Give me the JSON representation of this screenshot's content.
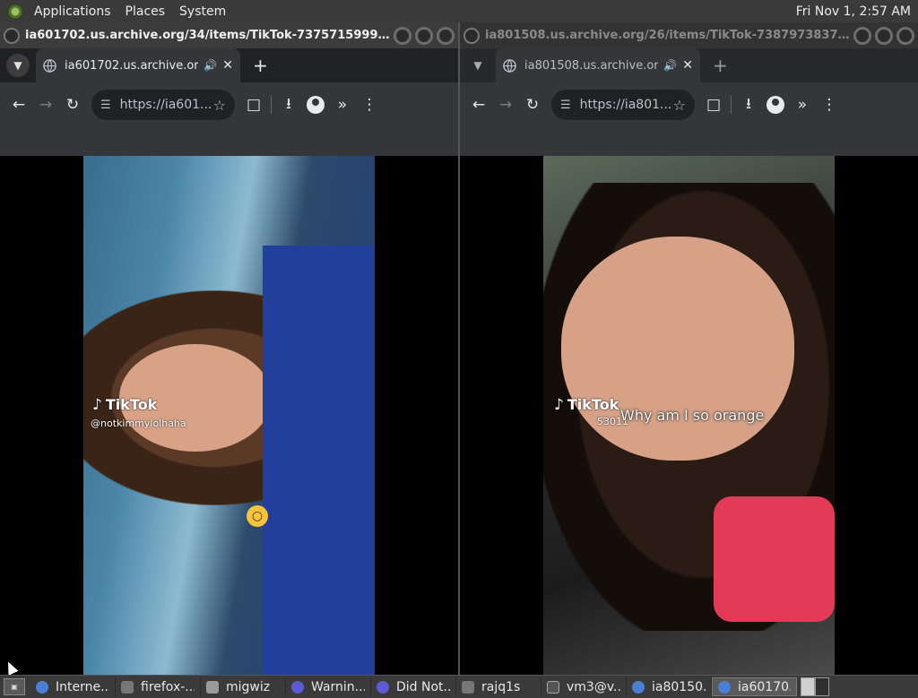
{
  "panel": {
    "menus": [
      "Applications",
      "Places",
      "System"
    ],
    "clock": "Fri Nov 1,  2:57 AM"
  },
  "left_window": {
    "title": "ia601702.us.archive.org/34/items/TikTok-737571599941430...",
    "tab_title": "ia601702.us.archive.org/3",
    "url": "https://ia601...",
    "video": {
      "brand": "TikTok",
      "username": "@notkimmylolhaha"
    }
  },
  "right_window": {
    "title": "ia801508.us.archive.org/26/items/TikTok-738797383789324...",
    "tab_title": "ia801508.us.archive.org/",
    "url": "https://ia801...",
    "video": {
      "brand": "TikTok",
      "username": "53011",
      "caption": "Why am I so orange"
    }
  },
  "taskbar": {
    "items": [
      {
        "label": "Interne...",
        "icon": "chrome-icon"
      },
      {
        "label": "firefox-...",
        "icon": "terminal-icon"
      },
      {
        "label": "migwiz",
        "icon": "folder-icon"
      },
      {
        "label": "Warnin...",
        "icon": "firefox-icon"
      },
      {
        "label": "Did Not...",
        "icon": "firefox-icon"
      },
      {
        "label": "rajq1s",
        "icon": "terminal-icon"
      },
      {
        "label": "vm3@v...",
        "icon": "terminal-icon"
      },
      {
        "label": "ia80150...",
        "icon": "chrome-icon"
      },
      {
        "label": "ia60170...",
        "icon": "chrome-icon"
      }
    ]
  },
  "colors": {
    "panel": "#3a3a3a",
    "toolbar": "#35363a",
    "tabstrip": "#202124"
  }
}
